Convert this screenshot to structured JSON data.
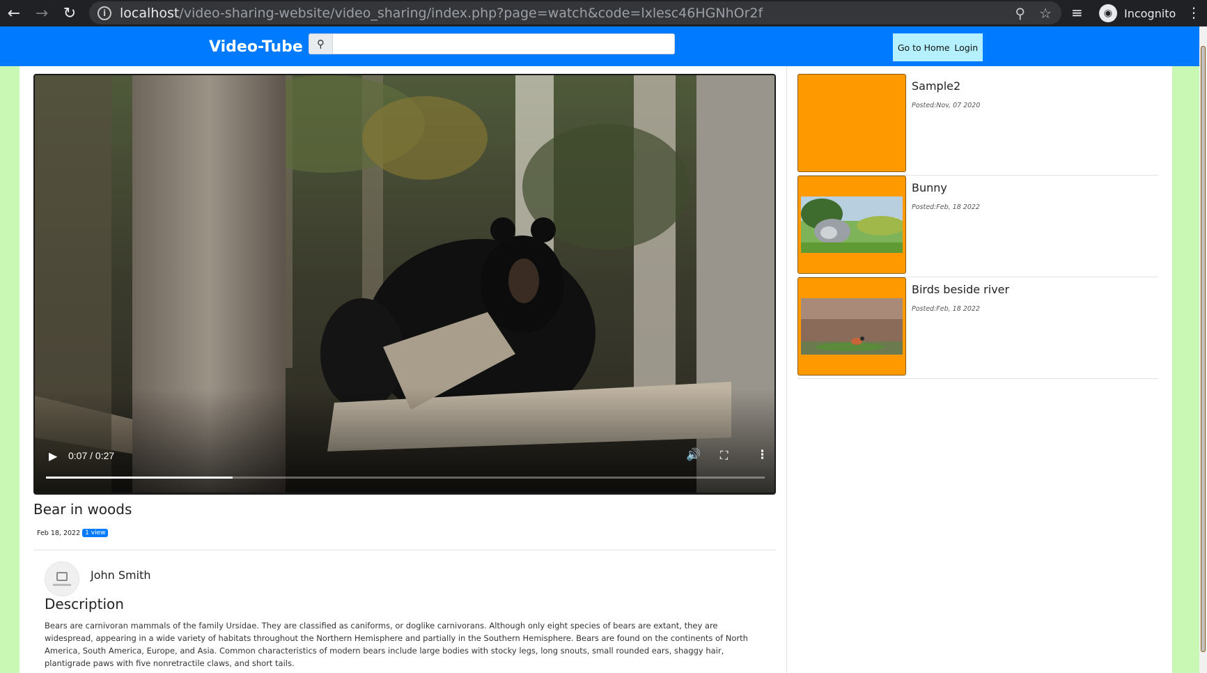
{
  "browser": {
    "url_host": "localhost",
    "url_path": "/video-sharing-website/video_sharing/index.php?page=watch&code=lxlesc46HGNhOr2f",
    "profile_label": "Incognito",
    "icons": {
      "back": "arrow-left-icon",
      "forward": "arrow-right-icon",
      "reload": "reload-icon",
      "site_info": "info-icon",
      "zoom": "zoom-icon",
      "bookmark": "star-icon",
      "media": "queue-music-icon",
      "incognito": "incognito-icon",
      "menu": "more-vertical-icon"
    }
  },
  "header": {
    "brand": "Video-Tube",
    "search": {
      "placeholder": "",
      "value": "",
      "icon": "search-icon"
    },
    "nav": [
      {
        "label": "Go to Home"
      },
      {
        "label": "Login"
      }
    ],
    "colors": {
      "bar": "#007bff",
      "nav_bg": "#b4f0fd",
      "page_bg": "#c9f7b4"
    }
  },
  "video": {
    "title": "Bear in woods",
    "date": "Feb 18, 2022",
    "views": "1 view",
    "player": {
      "current_time": "0:07",
      "duration": "0:27",
      "time_display": "0:07 / 0:27",
      "progress_fraction": 0.26
    },
    "author": {
      "name": "John Smith"
    },
    "description_heading": "Description",
    "description": "Bears are carnivoran mammals of the family Ursidae. They are classified as caniforms, or doglike carnivorans. Although only eight species of bears are extant, they are widespread, appearing in a wide variety of habitats throughout the Northern Hemisphere and partially in the Southern Hemisphere. Bears are found on the continents of North America, South America, Europe, and Asia. Common characteristics of modern bears include large bodies with stocky legs, long snouts, small rounded ears, shaggy hair, plantigrade paws with five nonretractile claws, and short tails."
  },
  "sidebar": {
    "items": [
      {
        "title": "Sample2",
        "posted": "Posted:Nov, 07 2020"
      },
      {
        "title": "Bunny",
        "posted": "Posted:Feb, 18 2022"
      },
      {
        "title": "Birds beside river",
        "posted": "Posted:Feb, 18 2022"
      }
    ],
    "thumb_color": "#ff9900"
  }
}
